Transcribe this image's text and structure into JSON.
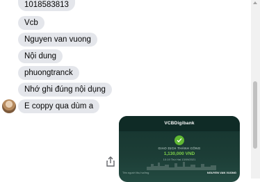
{
  "messages": [
    {
      "text": "1018583813"
    },
    {
      "text": "Vcb"
    },
    {
      "text": "Nguyen van vuong"
    },
    {
      "text": "Nội dung"
    },
    {
      "text": "phuongtranck"
    },
    {
      "text": "Nhớ ghi đúng nội dụng"
    },
    {
      "text": "E coppy qua dùm a"
    }
  ],
  "share_icon": "share-icon",
  "receipt": {
    "bank_name": "VCBDigibank",
    "status": "GIAO DỊCH THÀNH CÔNG",
    "amount": "1,130,000 VND",
    "time": "10:19 Thứ Hai 13/09/2021",
    "recipient_label": "Tên người thụ hưởng",
    "recipient_name": "NGUYEN VAN VUONG",
    "success_color": "#5fb832",
    "background_color": "#1c3d36"
  }
}
